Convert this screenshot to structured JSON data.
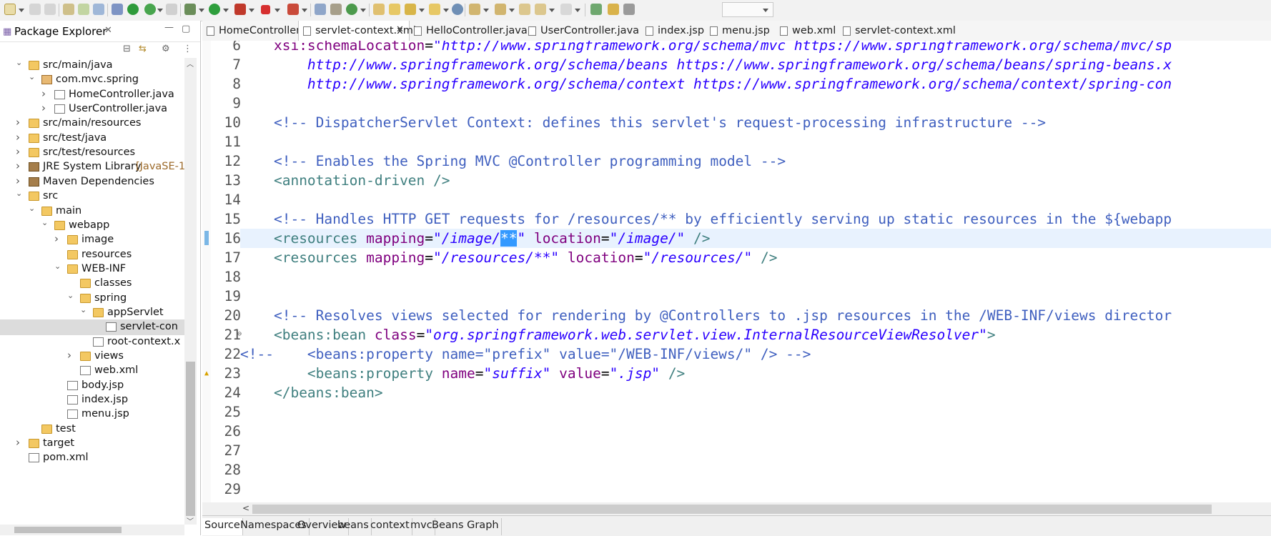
{
  "toolbar": {
    "icons": [
      "new-icon",
      "save-icon",
      "save-all-icon",
      "print-icon",
      "debug-icon",
      "run-icon",
      "coverage-icon",
      "external-tools-icon",
      "search-icon",
      "open-type-icon",
      "next-annotation-icon",
      "prev-annotation-icon",
      "back-icon",
      "forward-icon",
      "open-perspective-icon",
      "quick-access-icon"
    ],
    "combo_value": ""
  },
  "package_explorer": {
    "title": "Package Explorer",
    "close_glyph": "✕",
    "tree": [
      {
        "depth": 1,
        "twisty": "v",
        "icon": "srcf",
        "label": "src/main/java"
      },
      {
        "depth": 2,
        "twisty": "v",
        "icon": "pkg",
        "label": "com.mvc.spring"
      },
      {
        "depth": 3,
        "twisty": ">",
        "icon": "java",
        "label": "HomeController.java"
      },
      {
        "depth": 3,
        "twisty": ">",
        "icon": "java",
        "label": "UserController.java"
      },
      {
        "depth": 1,
        "twisty": ">",
        "icon": "srcf",
        "label": "src/main/resources"
      },
      {
        "depth": 1,
        "twisty": ">",
        "icon": "srcf",
        "label": "src/test/java"
      },
      {
        "depth": 1,
        "twisty": ">",
        "icon": "srcf",
        "label": "src/test/resources"
      },
      {
        "depth": 1,
        "twisty": ">",
        "icon": "jar",
        "label": "JRE System Library",
        "decoration": "[JavaSE-1"
      },
      {
        "depth": 1,
        "twisty": ">",
        "icon": "jar",
        "label": "Maven Dependencies"
      },
      {
        "depth": 1,
        "twisty": "v",
        "icon": "folder",
        "label": "src"
      },
      {
        "depth": 2,
        "twisty": "v",
        "icon": "folder",
        "label": "main"
      },
      {
        "depth": 3,
        "twisty": "v",
        "icon": "folder",
        "label": "webapp"
      },
      {
        "depth": 4,
        "twisty": ">",
        "icon": "folder",
        "label": "image"
      },
      {
        "depth": 4,
        "twisty": "",
        "icon": "folder",
        "label": "resources"
      },
      {
        "depth": 4,
        "twisty": "v",
        "icon": "folder",
        "label": "WEB-INF"
      },
      {
        "depth": 5,
        "twisty": "",
        "icon": "folder",
        "label": "classes"
      },
      {
        "depth": 5,
        "twisty": "v",
        "icon": "folder",
        "label": "spring"
      },
      {
        "depth": 6,
        "twisty": "v",
        "icon": "folder",
        "label": "appServlet"
      },
      {
        "depth": 7,
        "twisty": "",
        "icon": "xml",
        "label": "servlet-con",
        "selected": true
      },
      {
        "depth": 6,
        "twisty": "",
        "icon": "xml",
        "label": "root-context.x"
      },
      {
        "depth": 5,
        "twisty": ">",
        "icon": "folder",
        "label": "views"
      },
      {
        "depth": 5,
        "twisty": "",
        "icon": "xml",
        "label": "web.xml"
      },
      {
        "depth": 4,
        "twisty": "",
        "icon": "file",
        "label": "body.jsp"
      },
      {
        "depth": 4,
        "twisty": "",
        "icon": "file",
        "label": "index.jsp"
      },
      {
        "depth": 4,
        "twisty": "",
        "icon": "file",
        "label": "menu.jsp"
      },
      {
        "depth": 2,
        "twisty": "",
        "icon": "folder",
        "label": "test"
      },
      {
        "depth": 1,
        "twisty": ">",
        "icon": "folder",
        "label": "target"
      },
      {
        "depth": 1,
        "twisty": "",
        "icon": "xml",
        "label": "pom.xml"
      }
    ]
  },
  "editor_tabs": [
    {
      "label": "HomeController.java",
      "icon": "java-file-icon",
      "active": false
    },
    {
      "label": "servlet-context.xml",
      "icon": "xml-file-icon",
      "active": true,
      "close": "✕"
    },
    {
      "label": "HelloController.java",
      "icon": "java-file-icon",
      "active": false
    },
    {
      "label": "UserController.java",
      "icon": "java-file-icon",
      "active": false
    },
    {
      "label": "index.jsp",
      "icon": "jsp-file-icon",
      "active": false
    },
    {
      "label": "menu.jsp",
      "icon": "jsp-file-icon",
      "active": false
    },
    {
      "label": "web.xml",
      "icon": "xml-file-icon",
      "active": false
    },
    {
      "label": "servlet-context.xml",
      "icon": "xml-file-icon",
      "active": false
    }
  ],
  "editor": {
    "current_line": 16,
    "lines": [
      {
        "n": "6",
        "fold": "",
        "marker": "",
        "tokens": [
          [
            "plain",
            "    "
          ],
          [
            "attr",
            "xsi:schemaLocation"
          ],
          [
            "plain",
            "="
          ],
          [
            "str",
            "\"http://www.springframework.org/schema/mvc https://www.springframework.org/schema/mvc/sp"
          ]
        ]
      },
      {
        "n": "7",
        "fold": "",
        "marker": "",
        "tokens": [
          [
            "str",
            "        http://www.springframework.org/schema/beans https://www.springframework.org/schema/beans/spring-beans.x"
          ]
        ]
      },
      {
        "n": "8",
        "fold": "",
        "marker": "",
        "tokens": [
          [
            "str",
            "        http://www.springframework.org/schema/context https://www.springframework.org/schema/context/spring-con"
          ]
        ]
      },
      {
        "n": "9",
        "fold": "",
        "marker": "",
        "tokens": []
      },
      {
        "n": "10",
        "fold": "",
        "marker": "",
        "tokens": [
          [
            "plain",
            "    "
          ],
          [
            "com",
            "<!-- DispatcherServlet Context: defines this servlet's request-processing infrastructure -->"
          ]
        ]
      },
      {
        "n": "11",
        "fold": "",
        "marker": "",
        "tokens": []
      },
      {
        "n": "12",
        "fold": "",
        "marker": "",
        "tokens": [
          [
            "plain",
            "    "
          ],
          [
            "com",
            "<!-- Enables the Spring MVC @Controller programming model -->"
          ]
        ]
      },
      {
        "n": "13",
        "fold": "",
        "marker": "",
        "tokens": [
          [
            "plain",
            "    "
          ],
          [
            "tag",
            "<annotation-driven />"
          ]
        ]
      },
      {
        "n": "14",
        "fold": "",
        "marker": "",
        "tokens": []
      },
      {
        "n": "15",
        "fold": "",
        "marker": "",
        "tokens": [
          [
            "plain",
            "    "
          ],
          [
            "com",
            "<!-- Handles HTTP GET requests for /resources/** by efficiently serving up static resources in the ${webapp"
          ]
        ]
      },
      {
        "n": "16",
        "fold": "",
        "marker": "bar",
        "tokens": [
          [
            "plain",
            "    "
          ],
          [
            "tag",
            "<resources "
          ],
          [
            "attr",
            "mapping"
          ],
          [
            "plain",
            "="
          ],
          [
            "str",
            "\"/image/"
          ],
          [
            "sel",
            "**"
          ],
          [
            "str",
            "\""
          ],
          [
            "plain",
            " "
          ],
          [
            "attr",
            "location"
          ],
          [
            "plain",
            "="
          ],
          [
            "str",
            "\"/image/\""
          ],
          [
            "plain",
            " "
          ],
          [
            "tag",
            "/>"
          ]
        ]
      },
      {
        "n": "17",
        "fold": "",
        "marker": "",
        "tokens": [
          [
            "plain",
            "    "
          ],
          [
            "tag",
            "<resources "
          ],
          [
            "attr",
            "mapping"
          ],
          [
            "plain",
            "="
          ],
          [
            "str",
            "\"/resources/**\""
          ],
          [
            "plain",
            " "
          ],
          [
            "attr",
            "location"
          ],
          [
            "plain",
            "="
          ],
          [
            "str",
            "\"/resources/\""
          ],
          [
            "plain",
            " "
          ],
          [
            "tag",
            "/>"
          ]
        ]
      },
      {
        "n": "18",
        "fold": "",
        "marker": "",
        "tokens": []
      },
      {
        "n": "19",
        "fold": "",
        "marker": "",
        "tokens": []
      },
      {
        "n": "20",
        "fold": "",
        "marker": "",
        "tokens": [
          [
            "plain",
            "    "
          ],
          [
            "com",
            "<!-- Resolves views selected for rendering by @Controllers to .jsp resources in the /WEB-INF/views director"
          ]
        ]
      },
      {
        "n": "21",
        "fold": "⊖",
        "marker": "",
        "tokens": [
          [
            "plain",
            "    "
          ],
          [
            "tag",
            "<beans:bean "
          ],
          [
            "attr",
            "class"
          ],
          [
            "plain",
            "="
          ],
          [
            "str",
            "\"org.springframework.web.servlet.view.InternalResourceViewResolver\""
          ],
          [
            "tag",
            ">"
          ]
        ]
      },
      {
        "n": "22",
        "fold": "",
        "marker": "",
        "tokens": [
          [
            "com",
            "<!--    <beans:property name=\"prefix\" value=\"/WEB-INF/views/\" /> -->"
          ]
        ]
      },
      {
        "n": "23",
        "fold": "",
        "marker": "warn",
        "tokens": [
          [
            "plain",
            "        "
          ],
          [
            "tag",
            "<beans:property "
          ],
          [
            "attr",
            "name"
          ],
          [
            "plain",
            "="
          ],
          [
            "str",
            "\"suffix\""
          ],
          [
            "plain",
            " "
          ],
          [
            "attr",
            "value"
          ],
          [
            "plain",
            "="
          ],
          [
            "str",
            "\".jsp\""
          ],
          [
            "plain",
            " "
          ],
          [
            "tag",
            "/>"
          ]
        ]
      },
      {
        "n": "24",
        "fold": "",
        "marker": "",
        "tokens": [
          [
            "plain",
            "    "
          ],
          [
            "tag",
            "</beans:bean>"
          ]
        ]
      },
      {
        "n": "25",
        "fold": "",
        "marker": "",
        "tokens": []
      },
      {
        "n": "26",
        "fold": "",
        "marker": "",
        "tokens": []
      },
      {
        "n": "27",
        "fold": "",
        "marker": "",
        "tokens": []
      },
      {
        "n": "28",
        "fold": "",
        "marker": "",
        "tokens": []
      },
      {
        "n": "29",
        "fold": "",
        "marker": "",
        "tokens": []
      }
    ]
  },
  "bottom_tabs": [
    {
      "label": "Source",
      "active": true
    },
    {
      "label": "Namespaces",
      "active": false
    },
    {
      "label": "Overview",
      "active": false
    },
    {
      "label": "beans",
      "active": false
    },
    {
      "label": "context",
      "active": false
    },
    {
      "label": "mvc",
      "active": false
    },
    {
      "label": "Beans Graph",
      "active": false
    }
  ],
  "colors": {
    "comment": "#3f5fbf",
    "tag": "#3f7f7f",
    "attr": "#7f007f",
    "string": "#2a00ff",
    "selection": "#3399ff",
    "current_line": "#e8f2fe"
  }
}
